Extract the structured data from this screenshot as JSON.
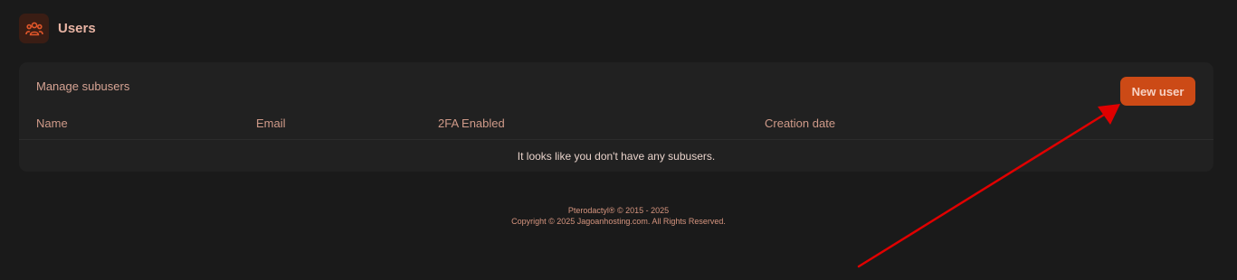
{
  "page": {
    "title": "Users",
    "header_icon": "users-icon"
  },
  "subusers_card": {
    "title": "Manage subusers",
    "new_user_label": "New user",
    "columns": [
      "Name",
      "Email",
      "2FA Enabled",
      "Creation date"
    ],
    "empty_message": "It looks like you don't have any subusers."
  },
  "footer": {
    "line1": "Pterodactyl® © 2015 - 2025",
    "line2": "Copyright © 2025 Jagoanhosting.com. All Rights Reserved."
  },
  "colors": {
    "background": "#1a1a1a",
    "card": "#212121",
    "accent": "#cc4a16",
    "annotation_arrow": "#e00000"
  },
  "annotation": {
    "type": "arrow",
    "points_to": "new-user-button"
  }
}
